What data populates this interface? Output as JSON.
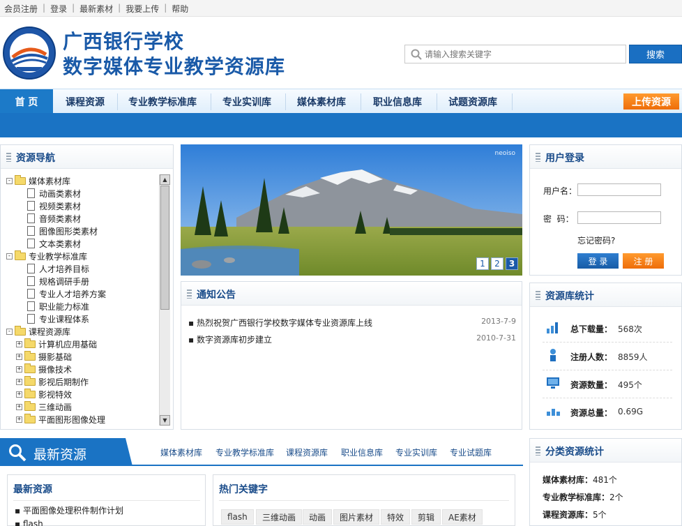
{
  "top_links": [
    "会员注册",
    "登录",
    "最新素材",
    "我要上传",
    "帮助"
  ],
  "logo": {
    "line1": "广西银行学校",
    "line2": "数字媒体专业教学资源库"
  },
  "search": {
    "placeholder": "请输入搜索关键字",
    "button": "搜索"
  },
  "nav": {
    "items": [
      "首 页",
      "课程资源",
      "专业教学标准库",
      "专业实训库",
      "媒体素材库",
      "职业信息库",
      "试题资源库"
    ],
    "upload": "上传资源"
  },
  "resource_nav": {
    "title": "资源导航",
    "tree": [
      {
        "label": "媒体素材库",
        "kind": "root",
        "pm": "-"
      },
      {
        "label": "动画类素材",
        "kind": "leaf"
      },
      {
        "label": "视频类素材",
        "kind": "leaf"
      },
      {
        "label": "音频类素材",
        "kind": "leaf"
      },
      {
        "label": "图像图形类素材",
        "kind": "leaf"
      },
      {
        "label": "文本类素材",
        "kind": "leaf"
      },
      {
        "label": "专业教学标准库",
        "kind": "root",
        "pm": "-"
      },
      {
        "label": "人才培养目标",
        "kind": "leaf"
      },
      {
        "label": "规格调研手册",
        "kind": "leaf"
      },
      {
        "label": "专业人才培养方案",
        "kind": "leaf"
      },
      {
        "label": "职业能力标准",
        "kind": "leaf"
      },
      {
        "label": "专业课程体系",
        "kind": "leaf"
      },
      {
        "label": "课程资源库",
        "kind": "root",
        "pm": "-"
      },
      {
        "label": "计算机应用基础",
        "kind": "sub",
        "pm": "+"
      },
      {
        "label": "摄影基础",
        "kind": "sub",
        "pm": "+"
      },
      {
        "label": "摄像技术",
        "kind": "sub",
        "pm": "+"
      },
      {
        "label": "影视后期制作",
        "kind": "sub",
        "pm": "+"
      },
      {
        "label": "影视特效",
        "kind": "sub",
        "pm": "+"
      },
      {
        "label": "三维动画",
        "kind": "sub",
        "pm": "+"
      },
      {
        "label": "平面图形图像处理",
        "kind": "sub",
        "pm": "+"
      }
    ]
  },
  "banner": {
    "brand": "neoiso",
    "pages": [
      "1",
      "2",
      "3"
    ]
  },
  "notices": {
    "title": "通知公告",
    "items": [
      {
        "text": "▪ 热烈祝贺广西银行学校数字媒体专业资源库上线",
        "date": "2013-7-9"
      },
      {
        "text": "▪ 数字资源库初步建立",
        "date": "2010-7-31"
      }
    ]
  },
  "login": {
    "title": "用户登录",
    "user_label": "用户名：",
    "pass_label": "密  码：",
    "forgot": "忘记密码?",
    "login_btn": "登 录",
    "register_btn": "注 册"
  },
  "stats": {
    "title": "资源库统计",
    "items": [
      {
        "label": "总下载量：",
        "value": "568次",
        "icon": "bar-chart-icon"
      },
      {
        "label": "注册人数：",
        "value": "8859人",
        "icon": "user-icon"
      },
      {
        "label": "资源数量：",
        "value": "495个",
        "icon": "monitor-icon"
      },
      {
        "label": "资源总量：",
        "value": "0.69G",
        "icon": "storage-icon"
      }
    ]
  },
  "latest": {
    "bar_title": "最新资源",
    "categories": [
      "媒体素材库",
      "专业教学标准库",
      "课程资源库",
      "职业信息库",
      "专业实训库",
      "专业试题库"
    ],
    "box_title": "最新资源",
    "items": [
      "▪ 平面图像处理积件制作计划",
      "▪ flash"
    ]
  },
  "hot_keywords": {
    "title": "热门关键字",
    "items": [
      "flash",
      "三维动画",
      "动画",
      "图片素材",
      "特效",
      "剪辑",
      "AE素材"
    ]
  },
  "category_stats": {
    "title": "分类资源统计",
    "items": [
      {
        "label": "媒体素材库：",
        "value": "481个"
      },
      {
        "label": "专业教学标准库：",
        "value": "2个"
      },
      {
        "label": "课程资源库：",
        "value": "5个"
      }
    ]
  },
  "colors": {
    "brand_blue": "#1a73c4",
    "orange": "#ee6d09",
    "title_blue": "#1a4c8a"
  }
}
